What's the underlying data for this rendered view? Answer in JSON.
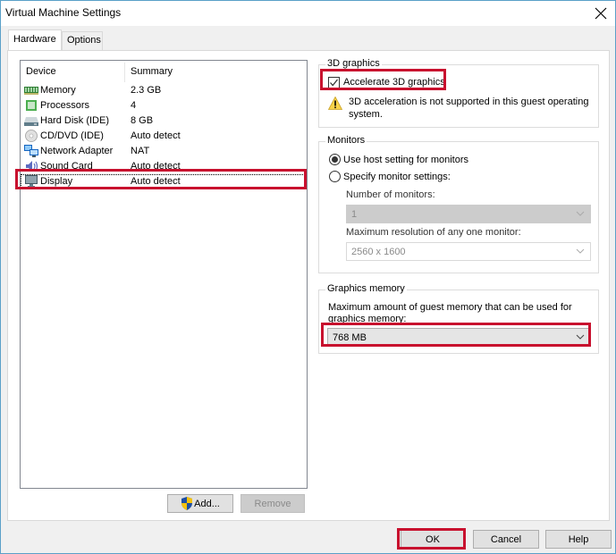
{
  "window": {
    "title": "Virtual Machine Settings",
    "close_icon": "close-icon"
  },
  "tabs": [
    {
      "label": "Hardware",
      "active": true
    },
    {
      "label": "Options",
      "active": false
    }
  ],
  "device_list": {
    "columns": [
      "Device",
      "Summary"
    ],
    "rows": [
      {
        "device": "Memory",
        "summary": "2.3 GB",
        "icon": "memory-icon"
      },
      {
        "device": "Processors",
        "summary": "4",
        "icon": "processor-icon"
      },
      {
        "device": "Hard Disk (IDE)",
        "summary": "8 GB",
        "icon": "hard-disk-icon"
      },
      {
        "device": "CD/DVD (IDE)",
        "summary": "Auto detect",
        "icon": "cd-dvd-icon"
      },
      {
        "device": "Network Adapter",
        "summary": "NAT",
        "icon": "network-adapter-icon"
      },
      {
        "device": "Sound Card",
        "summary": "Auto detect",
        "icon": "sound-card-icon"
      },
      {
        "device": "Display",
        "summary": "Auto detect",
        "icon": "display-icon",
        "selected": true
      }
    ],
    "add_label": "Add...",
    "remove_label": "Remove"
  },
  "graphics_3d": {
    "group_label": "3D graphics",
    "accelerate_label": "Accelerate 3D graphics",
    "accelerate_checked": true,
    "warning_text_line1": "3D acceleration is not supported in this guest operating",
    "warning_text_line2": "system."
  },
  "monitors": {
    "group_label": "Monitors",
    "use_host_label": "Use host setting for monitors",
    "use_host_selected": true,
    "specify_label": "Specify monitor settings:",
    "specify_selected": false,
    "number_label": "Number of monitors:",
    "number_value": "1",
    "max_res_label": "Maximum resolution of any one monitor:",
    "max_res_value": "2560 x 1600"
  },
  "graphics_memory": {
    "group_label": "Graphics memory",
    "description_line1": "Maximum amount of guest memory that can be used for",
    "description_line2": "graphics memory:",
    "value": "768 MB"
  },
  "footer": {
    "ok_label": "OK",
    "cancel_label": "Cancel",
    "help_label": "Help"
  },
  "colors": {
    "highlight": "#c8102e",
    "window_border": "#5aa0c8"
  }
}
